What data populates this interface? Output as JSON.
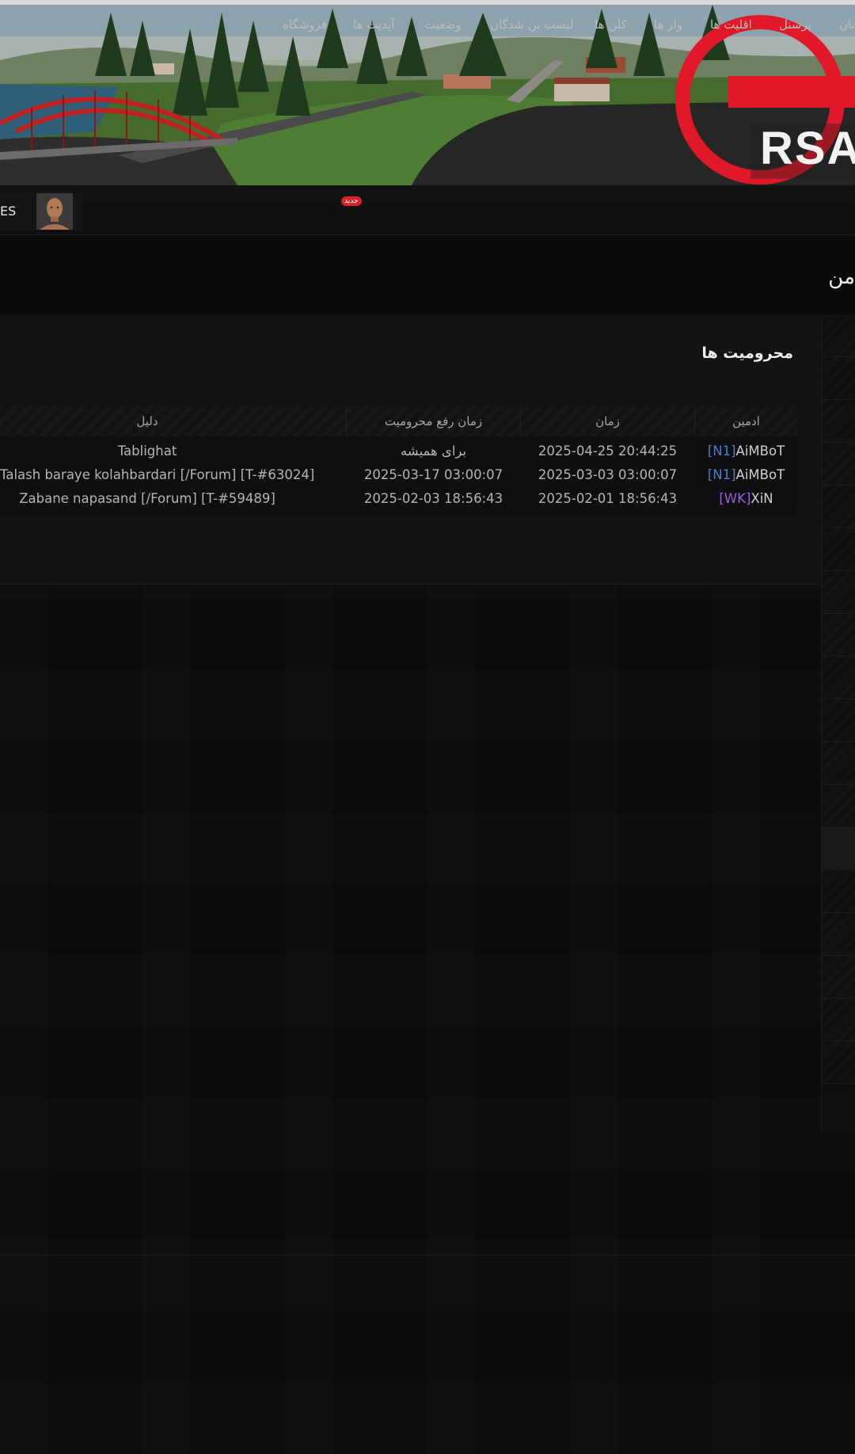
{
  "colors": {
    "accent_red": "#d8232a",
    "clan_tag_blue": "#4a7ec9",
    "clan_tag_purple": "#9a5ed6",
    "background": "#0c0c0e"
  },
  "header": {
    "logo_text": "RSA"
  },
  "nav": {
    "items": [
      {
        "label": "نان",
        "icon": ""
      },
      {
        "label": "پرسنل"
      },
      {
        "label": "اقلیت ها"
      },
      {
        "label": "وار ها"
      },
      {
        "label": "کلن ها"
      },
      {
        "label": "لیست بن شدگان"
      },
      {
        "label": "وضعیت"
      },
      {
        "label": "آپدیت ها",
        "badge": "جدید"
      },
      {
        "label": "فروشگاه"
      }
    ],
    "user": {
      "name_fragment": "ES",
      "avatar_icon": "avatar-icon"
    }
  },
  "page": {
    "title": "من"
  },
  "bans": {
    "title": "محرومیت ها",
    "columns": {
      "admin": "ادمین",
      "time": "زمان",
      "unban_time": "زمان رفع محرومیت",
      "reason": "دلیل"
    },
    "rows": [
      {
        "admin_tag": "[N1]",
        "admin_name": "AiMBoT",
        "time": "2025-04-25 20:44:25",
        "unban_time": "برای همیشه",
        "reason": "Tablighat"
      },
      {
        "admin_tag": "[N1]",
        "admin_name": "AiMBoT",
        "time": "2025-03-03 03:00:07",
        "unban_time": "2025-03-17 03:00:07",
        "reason": "Talash baraye kolahbardari [/Forum] [T-#63024]"
      },
      {
        "admin_tag": "[WK]",
        "admin_name": "XiN",
        "time": "2025-02-01 18:56:43",
        "unban_time": "2025-02-03 18:56:43",
        "reason": "Zabane napasand [/Forum] [T-#59489]"
      }
    ]
  }
}
